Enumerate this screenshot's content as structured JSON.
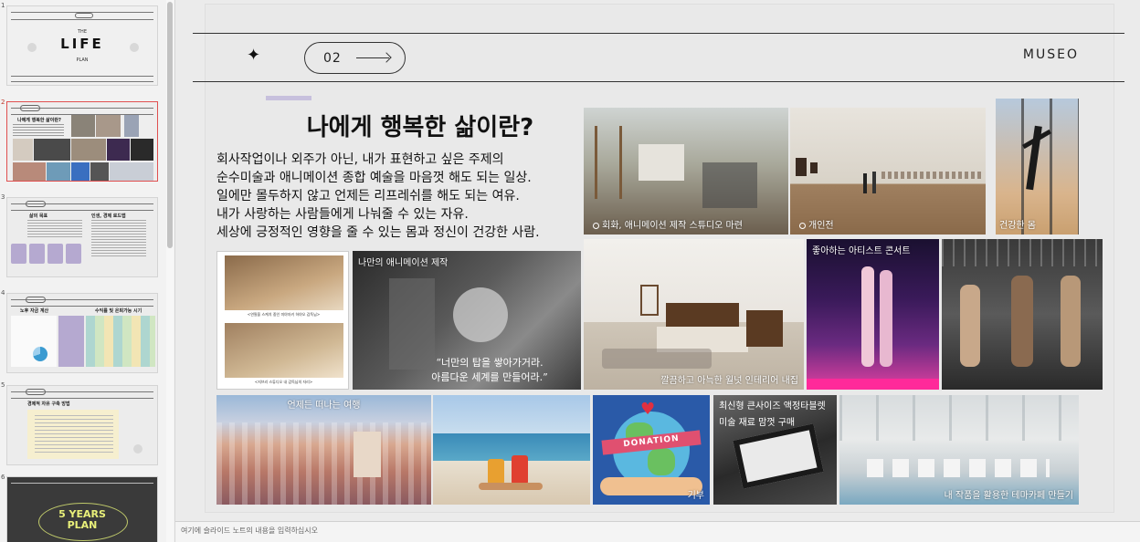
{
  "thumbnails": {
    "items": [
      {
        "num": "1",
        "title": "LIFE",
        "sub_top": "THE",
        "sub_bottom": "PLAN"
      },
      {
        "num": "2",
        "title": "나에게 행복한 삶이란?"
      },
      {
        "num": "3",
        "left_head": "삶의 목표",
        "right_head": "인생, 경제 로드맵"
      },
      {
        "num": "4",
        "left_head": "노후 자금 계산",
        "right_head": "수익률 및 은퇴가능 시기"
      },
      {
        "num": "5",
        "left_head": "경제적 자유 구축 방법"
      },
      {
        "num": "6",
        "title_line1": "5 YEARS",
        "title_line2": "PLAN"
      }
    ]
  },
  "slide": {
    "page_number": "02",
    "brand": "MUSEO",
    "title": "나에게 행복한 삶이란?",
    "body_lines": [
      "회사작업이나 외주가 아닌, 내가 표현하고 싶은 주제의",
      "순수미술과 애니메이션 종합 예술을 마음껏 해도 되는 일상.",
      "일에만 몰두하지 않고 언제든 리프레쉬를 해도 되는 여유.",
      "내가 사랑하는 사람들에게 나눠줄 수 있는 자유.",
      "세상에 긍정적인 영향을 줄 수 있는 몸과 정신이 건강한 사람."
    ],
    "photos": {
      "studio": "회화, 애니메이션 제작 스튜디오 마련",
      "exhibition": "개인전",
      "health": "건강한 몸",
      "my_animation": "나만의 애니메이션 제작",
      "quote_line1": "“너만의 탑을 쌓아가거라.",
      "quote_line2": "아름다운 세계를 만들어라.”",
      "collage_cap1": "<연필을 스케치 중인 미야자키 하야오 감독님>",
      "collage_cap2": "<지브리 스튜디오 내 감독님의 자리>",
      "interior": "깔끔하고 아늑한 월넛 인테리어 내집",
      "concert": "좋아하는 아티스트 콘서트",
      "travel": "언제든 떠나는 여행",
      "donation_badge": "DONATION",
      "donation": "기부",
      "tablet_line1": "최신형 큰사이즈 액정타블렛",
      "tablet_line2": "미술 재료 맘껏 구매",
      "cafe": "내 작품을 활용한 테마카페 만들기"
    }
  },
  "notes": {
    "placeholder": "여기에 슬라이드 노트의 내용을 입력하십시오"
  },
  "colors": {
    "accent_purple": "#c7c0dd",
    "selection_red": "#e05050"
  }
}
